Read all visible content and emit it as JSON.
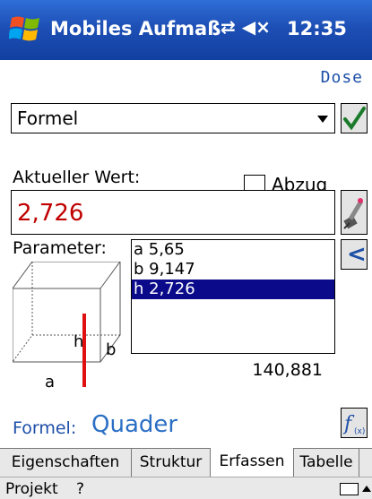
{
  "titlebar": {
    "app_title": "Mobiles Aufmaß",
    "status": "⇄ ◀×",
    "clock": "12:35"
  },
  "header": {
    "link": "Dose"
  },
  "formula_select": {
    "value": "Formel"
  },
  "abzug": {
    "label": "Abzug",
    "checked": false
  },
  "current_value": {
    "label": "Aktueller Wert:",
    "value": "2,726"
  },
  "parameters": {
    "label": "Parameter:",
    "items": [
      "a 5,65",
      "b 9,147",
      "h 2,726"
    ],
    "selected_index": 2
  },
  "diagram": {
    "labels": {
      "a": "a",
      "b": "b",
      "h": "h"
    }
  },
  "result": "140,881",
  "formula": {
    "label": "Formel:",
    "name": "Quader"
  },
  "tabs": [
    {
      "label": "Eigenschaften",
      "active": false
    },
    {
      "label": "Struktur",
      "active": false
    },
    {
      "label": "Erfassen",
      "active": true
    },
    {
      "label": "Tabelle",
      "active": false
    }
  ],
  "menubar": {
    "projekt": "Projekt",
    "help": "?"
  },
  "colors": {
    "title_bar": "#1d4fb5",
    "accent": "#1d4fa8",
    "value_red": "#c00000",
    "selection": "#0a0a8a",
    "highlight_edge": "#e01010"
  }
}
